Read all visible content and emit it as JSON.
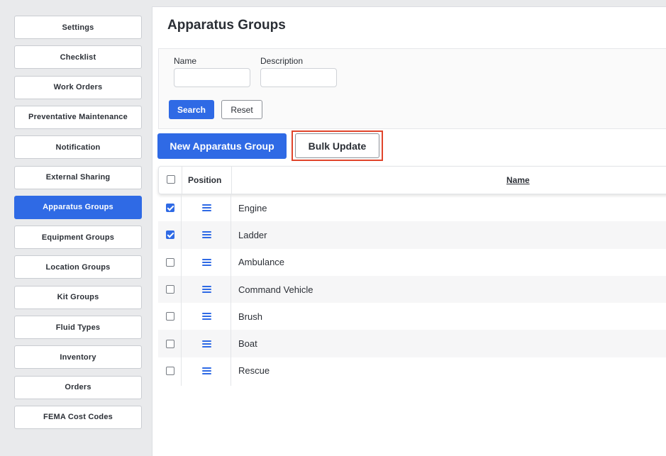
{
  "sidebar": {
    "items": [
      {
        "label": "Settings",
        "active": false
      },
      {
        "label": "Checklist",
        "active": false
      },
      {
        "label": "Work Orders",
        "active": false
      },
      {
        "label": "Preventative Maintenance",
        "active": false
      },
      {
        "label": "Notification",
        "active": false
      },
      {
        "label": "External Sharing",
        "active": false
      },
      {
        "label": "Apparatus Groups",
        "active": true
      },
      {
        "label": "Equipment Groups",
        "active": false
      },
      {
        "label": "Location Groups",
        "active": false
      },
      {
        "label": "Kit Groups",
        "active": false
      },
      {
        "label": "Fluid Types",
        "active": false
      },
      {
        "label": "Inventory",
        "active": false
      },
      {
        "label": "Orders",
        "active": false
      },
      {
        "label": "FEMA Cost Codes",
        "active": false
      }
    ]
  },
  "page": {
    "title": "Apparatus Groups"
  },
  "filters": {
    "name_label": "Name",
    "name_value": "",
    "description_label": "Description",
    "description_value": "",
    "search_label": "Search",
    "reset_label": "Reset"
  },
  "actions": {
    "new_label": "New Apparatus Group",
    "bulk_label": "Bulk Update"
  },
  "table": {
    "columns": {
      "position": "Position",
      "name": "Name"
    },
    "header_checked": false,
    "rows": [
      {
        "name": "Engine",
        "checked": true
      },
      {
        "name": "Ladder",
        "checked": true
      },
      {
        "name": "Ambulance",
        "checked": false
      },
      {
        "name": "Command Vehicle",
        "checked": false
      },
      {
        "name": "Brush",
        "checked": false
      },
      {
        "name": "Boat",
        "checked": false
      },
      {
        "name": "Rescue",
        "checked": false
      }
    ]
  },
  "colors": {
    "accent": "#2f6ae5",
    "highlight": "#e0442b"
  },
  "icons": {
    "position_handle": "drag-handle-icon"
  }
}
